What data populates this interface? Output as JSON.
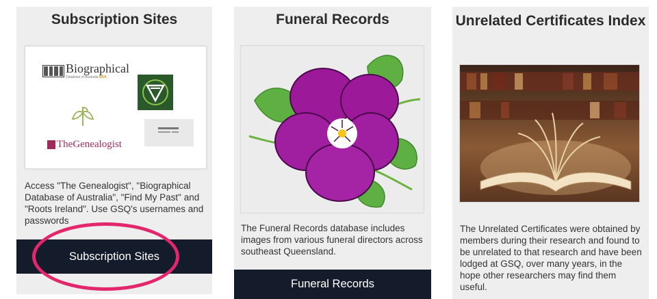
{
  "cards": [
    {
      "title": "Subscription Sites",
      "description": "Access \"The Genealogist\", \"Biographical Database of Australia\", \"Find My Past\" and \"Roots Ireland\". Use GSQ's usernames and passwords",
      "button_label": "Subscription Sites",
      "logos": {
        "biographical_title": "Biographical",
        "biographical_sub": "Database of Australia",
        "biographical_badge": "BDA",
        "thegenealogist": "TheGenealogist"
      }
    },
    {
      "title": "Funeral Records",
      "description": "The Funeral Records database includes images from various funeral directors across southeast Queensland.",
      "button_label": "Funeral Records",
      "image_icon": "pansy-flower-icon"
    },
    {
      "title": "Unrelated Certificates Index",
      "description": "The Unrelated Certificates were obtained by members during their research and found to be unrelated to that research and have been lodged at GSQ, over many years, in the hope other researchers may find them useful.",
      "image_icon": "open-book-library-icon"
    }
  ],
  "annotation": {
    "color": "#e3276d"
  }
}
